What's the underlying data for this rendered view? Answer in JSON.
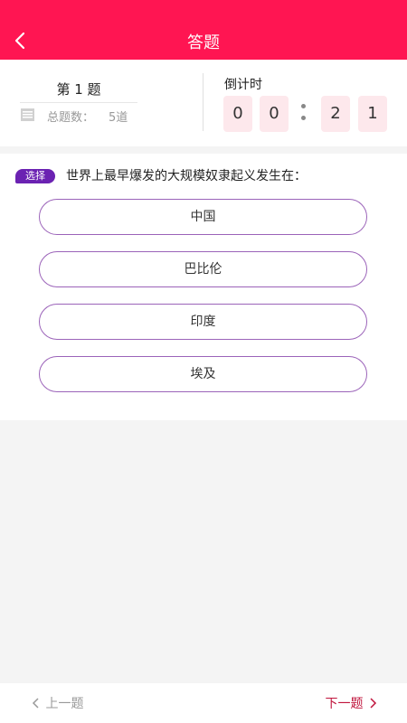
{
  "header": {
    "title": "答题",
    "back_icon": "chevron-left-icon",
    "bg_color": "#ff1552"
  },
  "info": {
    "question_number": "第 1 题",
    "total_label": "总题数：",
    "total_value": "5道",
    "countdown_label": "倒计时",
    "countdown_digits": [
      "0",
      "0",
      "2",
      "1"
    ]
  },
  "question": {
    "tag": "选择",
    "text": "世界上最早爆发的大规模奴隶起义发生在：",
    "options": [
      "中国",
      "巴比伦",
      "印度",
      "埃及"
    ]
  },
  "footer": {
    "prev_label": "上一题",
    "next_label": "下一题"
  },
  "colors": {
    "accent": "#ff1552",
    "tag": "#6b22b2",
    "option_border": "#9b63b9",
    "next": "#c0143c"
  }
}
